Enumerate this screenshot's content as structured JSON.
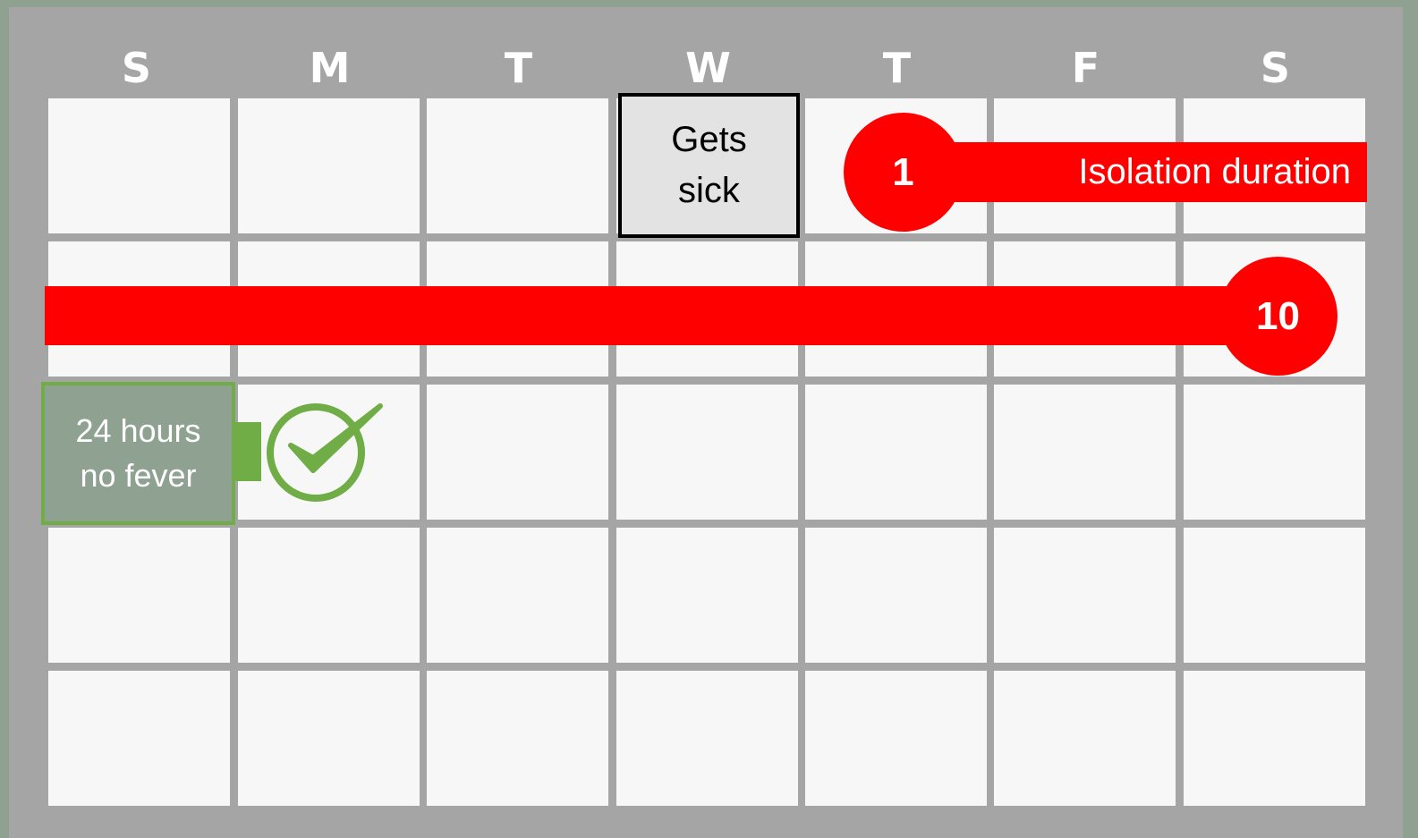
{
  "calendar": {
    "weekdays": [
      "S",
      "M",
      "T",
      "W",
      "T",
      "F",
      "S"
    ],
    "weeks": 5
  },
  "event": {
    "line1": "Gets",
    "line2": "sick"
  },
  "isolation": {
    "start_day": "1",
    "label": "Isolation duration",
    "end_day": "10",
    "color": "#ff0000"
  },
  "fever_check": {
    "line1": "24 hours",
    "line2": "no fever",
    "color": "#70ad47",
    "icon": "checkmark-circle-icon"
  }
}
